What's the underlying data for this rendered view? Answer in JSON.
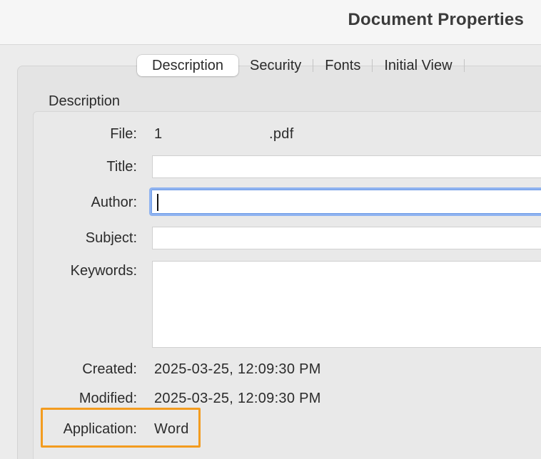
{
  "window": {
    "title": "Document Properties"
  },
  "tabs": [
    {
      "label": "Description",
      "active": true
    },
    {
      "label": "Security",
      "active": false
    },
    {
      "label": "Fonts",
      "active": false
    },
    {
      "label": "Initial View",
      "active": false
    }
  ],
  "description": {
    "section_label": "Description",
    "file_label": "File:",
    "file_value_start": "1",
    "file_value_end": ".pdf",
    "title_label": "Title:",
    "title_value": "",
    "author_label": "Author:",
    "author_value": "",
    "subject_label": "Subject:",
    "subject_value": "",
    "keywords_label": "Keywords:",
    "keywords_value": "",
    "created_label": "Created:",
    "created_value": "2025-03-25, 12:09:30 PM",
    "modified_label": "Modified:",
    "modified_value": "2025-03-25, 12:09:30 PM",
    "application_label": "Application:",
    "application_value": "Word"
  },
  "colors": {
    "highlight": "#f39c1f",
    "focus_ring": "#8fb3f0"
  }
}
